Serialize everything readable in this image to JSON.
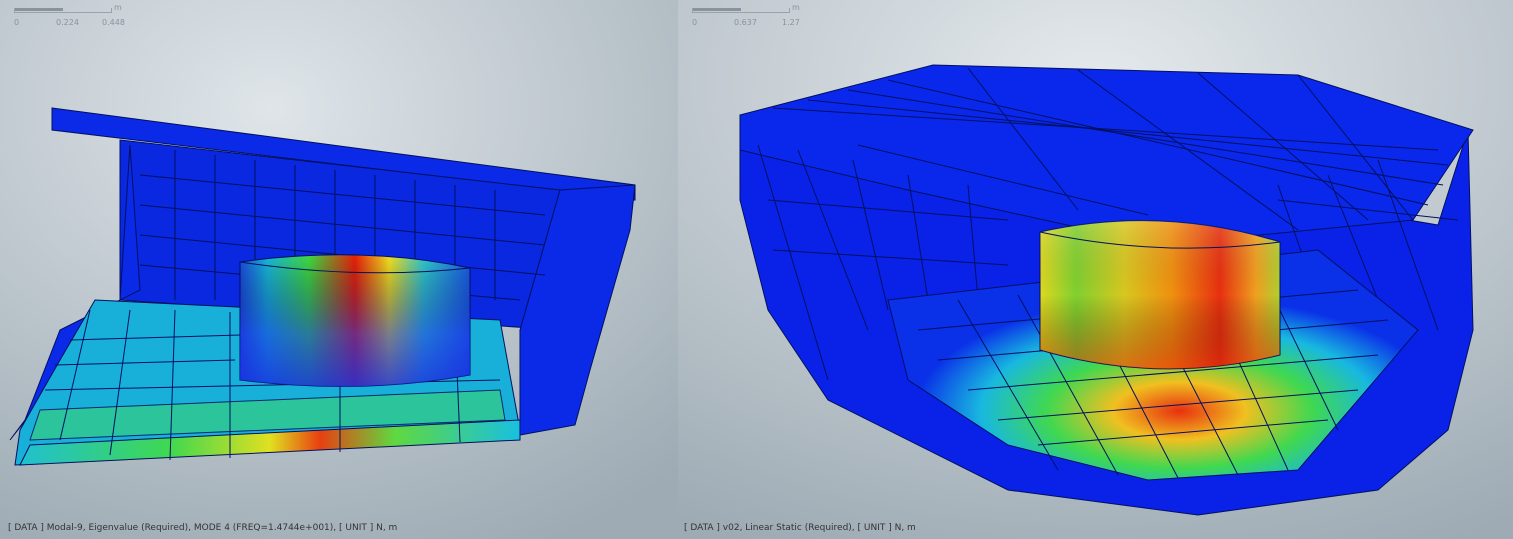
{
  "left_view": {
    "scale": {
      "unit": "m",
      "ticks": [
        "0",
        "0.224",
        "0.448"
      ]
    },
    "status_text": "[ DATA ] Modal-9,  Eigenvalue (Required),  MODE 4 (FREQ=1.4744e+001),   [ UNIT ]   N,  m"
  },
  "right_view": {
    "scale": {
      "unit": "m",
      "ticks": [
        "0",
        "0.637",
        "1.27"
      ]
    },
    "status_text": "[ DATA ] v02,  Linear Static (Required),   [ UNIT ]   N,  m"
  },
  "colors": {
    "structure_blue": "#0a22e8",
    "hot_red": "#e8200a",
    "background": "#b8c4cc"
  }
}
